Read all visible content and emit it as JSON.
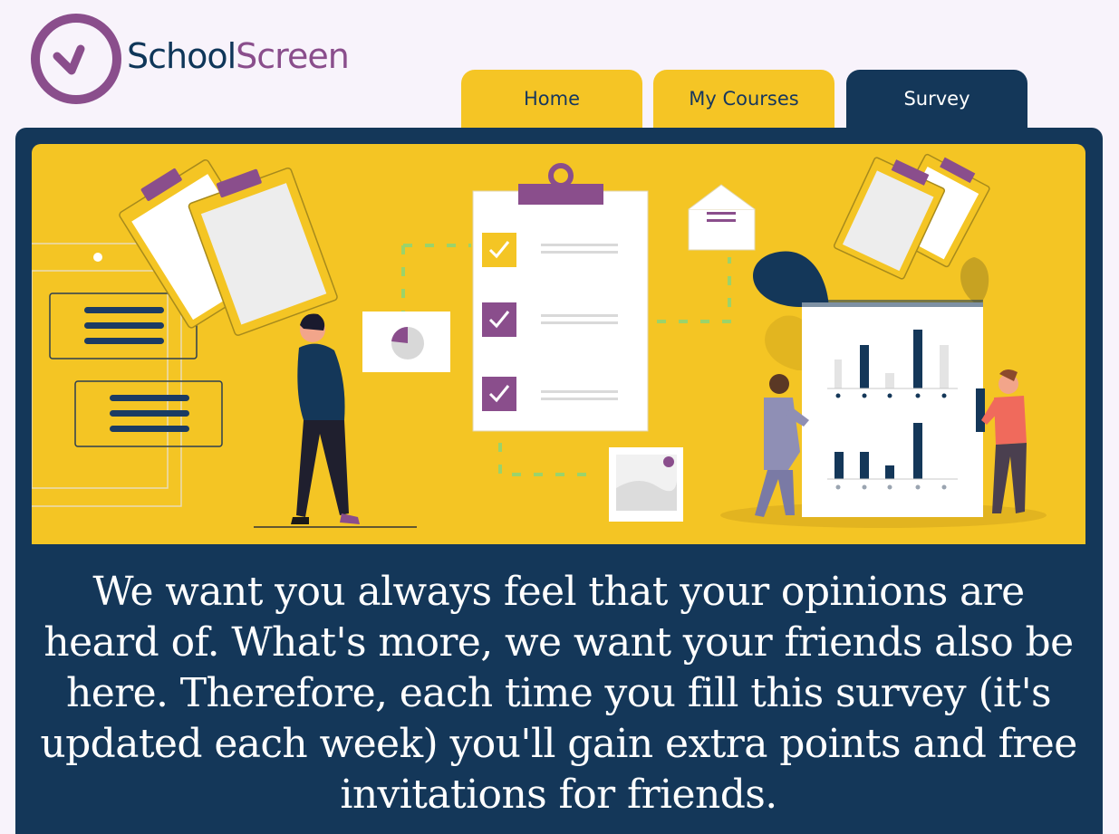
{
  "brand": {
    "name_part1": "School",
    "name_part2": "Screen",
    "mark_color": "#8a4e8c",
    "text_color": "#0f3659"
  },
  "nav": {
    "tabs": [
      {
        "label": "Home",
        "active": false
      },
      {
        "label": "My Courses",
        "active": false
      },
      {
        "label": "Survey",
        "active": true
      }
    ]
  },
  "colors": {
    "navy": "#143759",
    "yellow": "#f4c524",
    "purple": "#8a4e8c",
    "background": "#f8f3fb"
  },
  "hero": {
    "illustration": "survey-clipboard-illustration"
  },
  "main": {
    "message": "We want you always feel that your opinions are heard of. What's more, we want your friends also be here. Therefore, each time you fill this survey (it's updated each week) you'll gain extra points and free invitations for friends."
  }
}
